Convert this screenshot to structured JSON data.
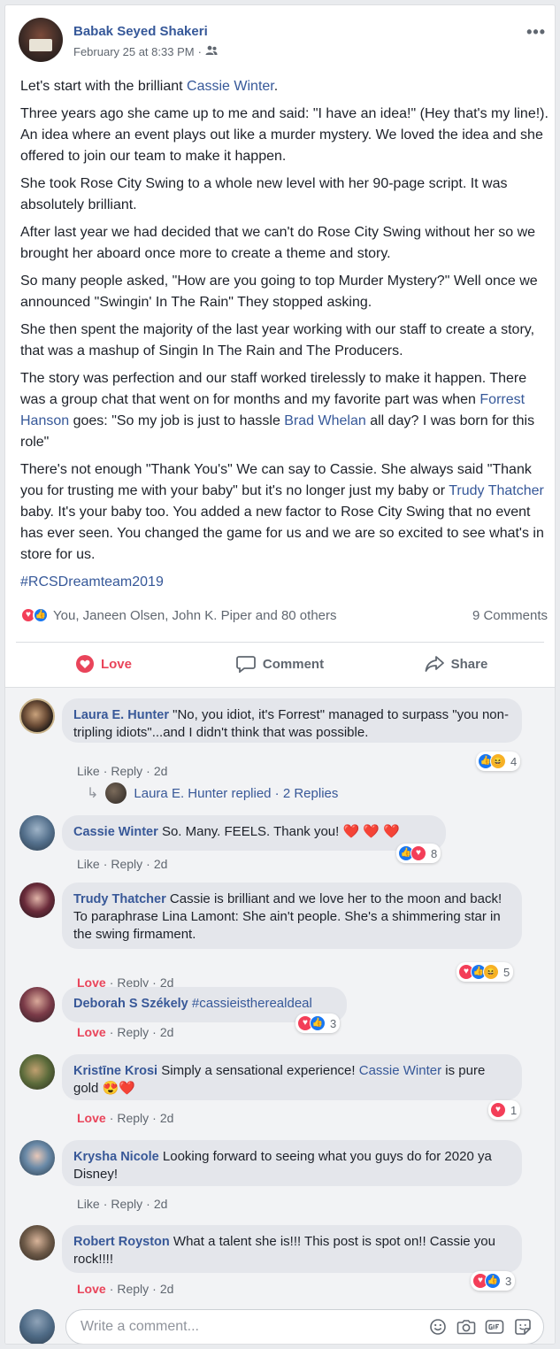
{
  "post": {
    "author": "Babak Seyed Shakeri",
    "timestamp": "February 25 at 8:33 PM",
    "privacy_sep": "·",
    "body": {
      "p1_pre": "Let's start with the brilliant ",
      "p1_link": "Cassie Winter",
      "p1_post": ".",
      "p2": "Three years ago she came up to me and said: \"I have an idea!\" (Hey that's my line!). An idea where an event plays out like a murder mystery. We loved the idea and she offered to join our team to make it happen.",
      "p3": "She took Rose City Swing to a whole new level with her 90-page script. It was absolutely brilliant.",
      "p4": "After last year we had decided that we can't do Rose City Swing without her so we brought her aboard once more to create a theme and story.",
      "p5": "So many people asked, \"How are you going to top Murder Mystery?\" Well once we announced \"Swingin' In The Rain\" They stopped asking.",
      "p6": "She then spent the majority of the last year working with our staff to create a story, that was a mashup of Singin In The Rain and The Producers.",
      "p7_a": "The story was perfection and our staff worked tirelessly to make it happen. There was a group chat that went on for months and my favorite part was when ",
      "p7_link1": "Forrest Hanson",
      "p7_b": " goes: \"So my job is just to hassle ",
      "p7_link2": "Brad Whelan",
      "p7_c": " all day? I was born for this role\"",
      "p8_a": "There's not enough \"Thank You's\" We can say to Cassie. She always said \"Thank you for trusting me with your baby\" but it's no longer just my baby or ",
      "p8_link": "Trudy Thatcher",
      "p8_b": " baby. It's your baby too. You added a new factor to Rose City Swing that no event has ever seen. You changed the game for us and we are so excited to see what's in store for us.",
      "hashtag": "#RCSDreamteam2019"
    },
    "reactions_text": "You, Janeen Olsen, John K. Piper and 80 others",
    "comments_count": "9 Comments"
  },
  "actions": {
    "love": "Love",
    "comment": "Comment",
    "share": "Share"
  },
  "comments": [
    {
      "name": "Laura E. Hunter",
      "text": "\"No, you idiot, it's Forrest\" managed to surpass \"you non-tripling idiots\"...and I didn't think that was possible.",
      "reaction": "Like",
      "reply": "Reply",
      "age": "2d",
      "react_count": "4"
    },
    {
      "name": "Cassie Winter",
      "text": "So. Many. FEELS. Thank you! ❤️ ❤️ ❤️",
      "reaction": "Like",
      "reply": "Reply",
      "age": "2d",
      "react_count": "8"
    },
    {
      "name": "Trudy Thatcher",
      "text": "Cassie is brilliant and we love her to the moon and back! To paraphrase Lina Lamont: She ain't people. She's a shimmering star in the swing firmament.",
      "reaction": "Love",
      "reply": "Reply",
      "age": "2d",
      "react_count": "5"
    },
    {
      "name": "Deborah S Székely",
      "text": "#cassieistherealdeal",
      "reaction": "Love",
      "reply": "Reply",
      "age": "2d",
      "react_count": "3"
    },
    {
      "name": "Kristīne Krosi",
      "text_pre": "Simply a sensational experience! ",
      "text_link": "Cassie Winter",
      "text_post": " is pure gold 😍❤️",
      "reaction": "Love",
      "reply": "Reply",
      "age": "2d",
      "react_count": "1"
    },
    {
      "name": "Krysha Nicole",
      "text": "Looking forward to seeing what you guys do for 2020 ya Disney!",
      "reaction": "Like",
      "reply": "Reply",
      "age": "2d"
    },
    {
      "name": "Robert Royston",
      "text": "What a talent she is!!! This post is spot on!! Cassie you rock!!!!",
      "reaction": "Love",
      "reply": "Reply",
      "age": "2d",
      "react_count": "3"
    }
  ],
  "reply_thread": {
    "name": "Laura E. Hunter",
    "replied": " replied · ",
    "count": "2 Replies"
  },
  "write_comment": {
    "placeholder": "Write a comment..."
  },
  "colors": {
    "link": "#365899",
    "love": "#e9445a",
    "like": "#1877f2",
    "bubble": "#e4e6eb"
  },
  "icons": [
    "friends-audience-icon",
    "more-options-icon",
    "love-reaction-icon",
    "like-reaction-icon",
    "haha-reaction-icon",
    "comment-icon",
    "share-icon",
    "reply-arrow-icon",
    "emoji-icon",
    "camera-icon",
    "gif-icon",
    "sticker-icon"
  ]
}
